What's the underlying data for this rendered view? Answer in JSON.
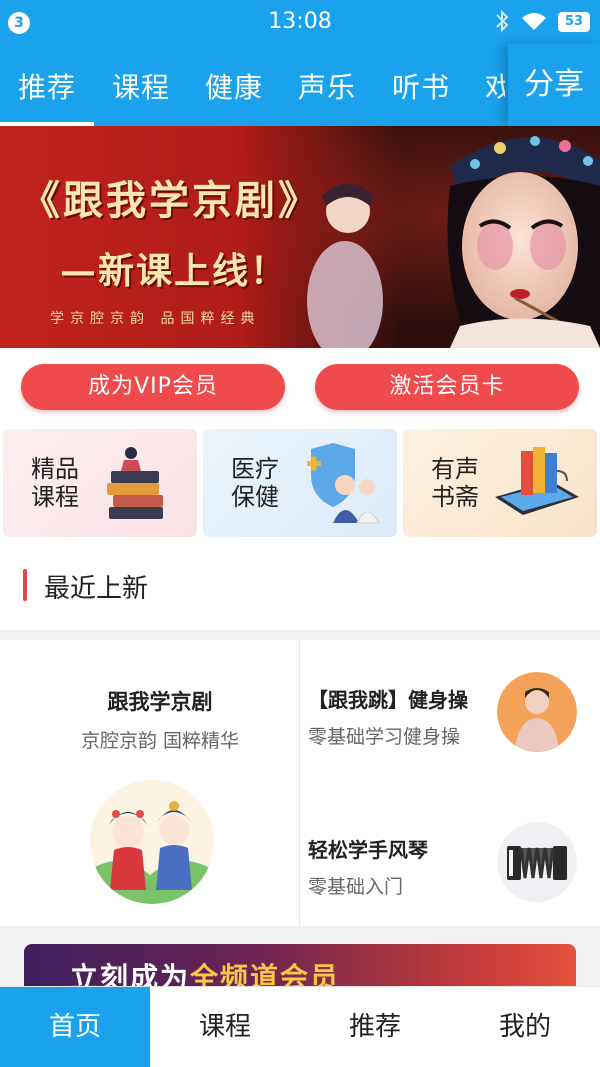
{
  "status_bar": {
    "notification_count": "3",
    "time": "13:08",
    "battery": "53",
    "icons": [
      "bluetooth-icon",
      "wifi-icon",
      "battery-icon"
    ]
  },
  "top_tabs": {
    "items": [
      "推荐",
      "课程",
      "健康",
      "声乐",
      "听书"
    ],
    "partial_item": "戏曲",
    "share_label": "分享",
    "active_index": 0
  },
  "banner": {
    "title": "《跟我学京剧》",
    "subtitle": "—新课上线！",
    "tagline": "学京腔京韵  品国粹经典"
  },
  "vip": {
    "become_vip_label": "成为VIP会员",
    "activate_card_label": "激活会员卡"
  },
  "categories": [
    {
      "label": "精品课程",
      "icon": "books-icon",
      "bg": "#fbe9ec"
    },
    {
      "label": "医疗保健",
      "icon": "medical-icon",
      "bg": "#e6f2fb"
    },
    {
      "label": "有声书斋",
      "icon": "audiobook-icon",
      "bg": "#fbecd9"
    }
  ],
  "recent": {
    "title": "最近上新",
    "featured": {
      "title": "跟我学京剧",
      "subtitle": "京腔京韵  国粹精华"
    },
    "courses": [
      {
        "title": "【跟我跳】健身操",
        "subtitle": "零基础学习健身操"
      },
      {
        "title": "轻松学手风琴",
        "subtitle": "零基础入门"
      }
    ]
  },
  "promo": {
    "text_prefix": "立刻成为",
    "text_highlight": "全频道会员"
  },
  "bottom_nav": {
    "items": [
      "首页",
      "课程",
      "推荐",
      "我的"
    ],
    "active_index": 0
  },
  "colors": {
    "primary": "#1aa2ec",
    "accent": "#ef4b4d"
  }
}
